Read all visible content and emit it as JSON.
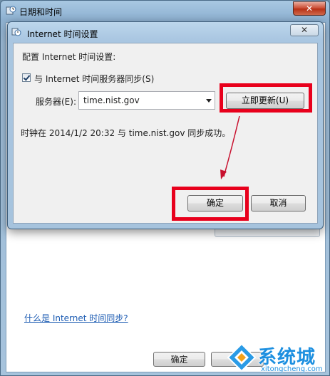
{
  "outer_window": {
    "title": "日期和时间",
    "close_glyph": "✕",
    "link_text": "什么是 Internet 时间同步?",
    "ok_label": "确定",
    "cancel_partial": "消"
  },
  "dialog": {
    "title": "Internet 时间设置",
    "close_glyph": "✕",
    "heading": "配置 Internet 时间设置:",
    "sync_checkbox_label": "与 Internet 时间服务器同步(S)",
    "sync_checked": true,
    "server_label": "服务器(E):",
    "server_value": "time.nist.gov",
    "update_button": "立即更新(U)",
    "status": "时钟在 2014/1/2 20:32 与 time.nist.gov 同步成功。",
    "ok_label": "确定",
    "cancel_label": "取消"
  },
  "annotation": {
    "highlight_color": "#e8001c",
    "arrow_color": "#c8102e"
  },
  "watermark": {
    "brand": "系统城",
    "url": "xitongcheng.com"
  },
  "icons": [
    "clock-globe-icon",
    "network-clock-icon",
    "close-icon",
    "dropdown-arrow-icon",
    "checkmark-icon",
    "watermark-logo-icon"
  ]
}
